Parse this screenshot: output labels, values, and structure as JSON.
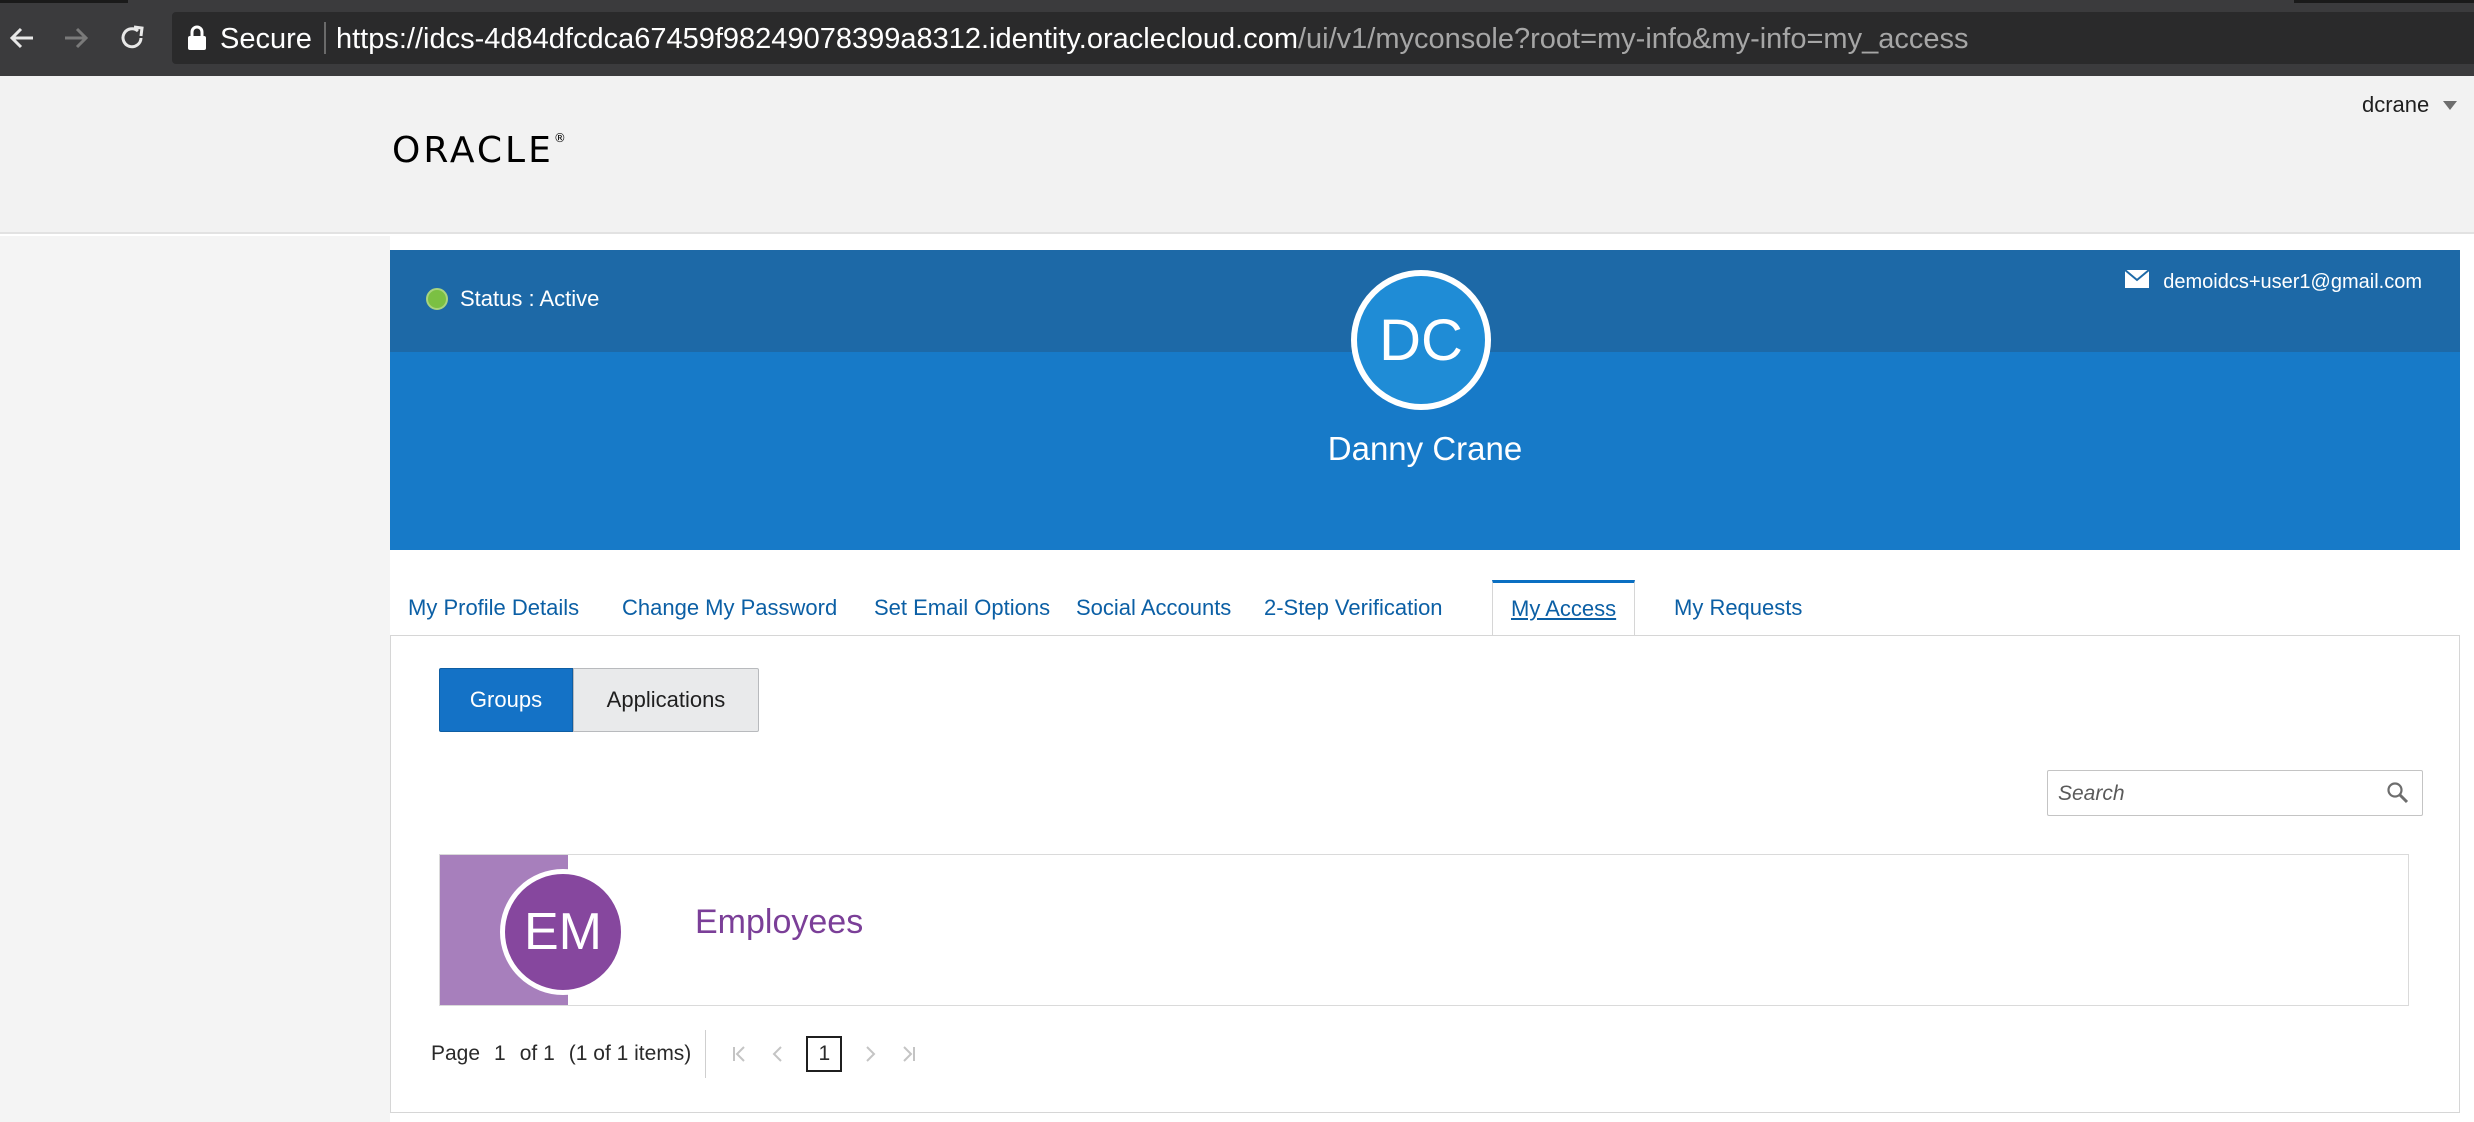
{
  "browser": {
    "secure_label": "Secure",
    "url_host": "https://idcs-4d84dfcdca67459f98249078399a8312.identity.oraclecloud.com",
    "url_path": "/ui/v1/myconsole?root=my-info&my-info=my_access"
  },
  "header": {
    "logo_text": "ORACLE",
    "logo_mark": "®",
    "username": "dcrane"
  },
  "profile": {
    "status_label": "Status : Active",
    "email": "demoidcs+user1@gmail.com",
    "initials": "DC",
    "full_name": "Danny Crane"
  },
  "tabs": [
    {
      "label": "My Profile Details"
    },
    {
      "label": "Change My Password"
    },
    {
      "label": "Set Email Options"
    },
    {
      "label": "Social Accounts"
    },
    {
      "label": "2-Step Verification"
    },
    {
      "label": "My Access"
    },
    {
      "label": "My Requests"
    }
  ],
  "access": {
    "segments": [
      {
        "label": "Groups"
      },
      {
        "label": "Applications"
      }
    ],
    "search_placeholder": "Search",
    "groups": [
      {
        "initials": "EM",
        "name": "Employees"
      }
    ],
    "pager": {
      "page_label": "Page",
      "current_page": "1",
      "of_label": "of 1",
      "items_label": "(1 of 1 items)",
      "page_button": "1"
    }
  },
  "colors": {
    "banner": "#177ac8",
    "banner_top": "#1d69a7",
    "accent": "#1472c6",
    "group_purple": "#86479e",
    "status_green": "#7bc043"
  }
}
